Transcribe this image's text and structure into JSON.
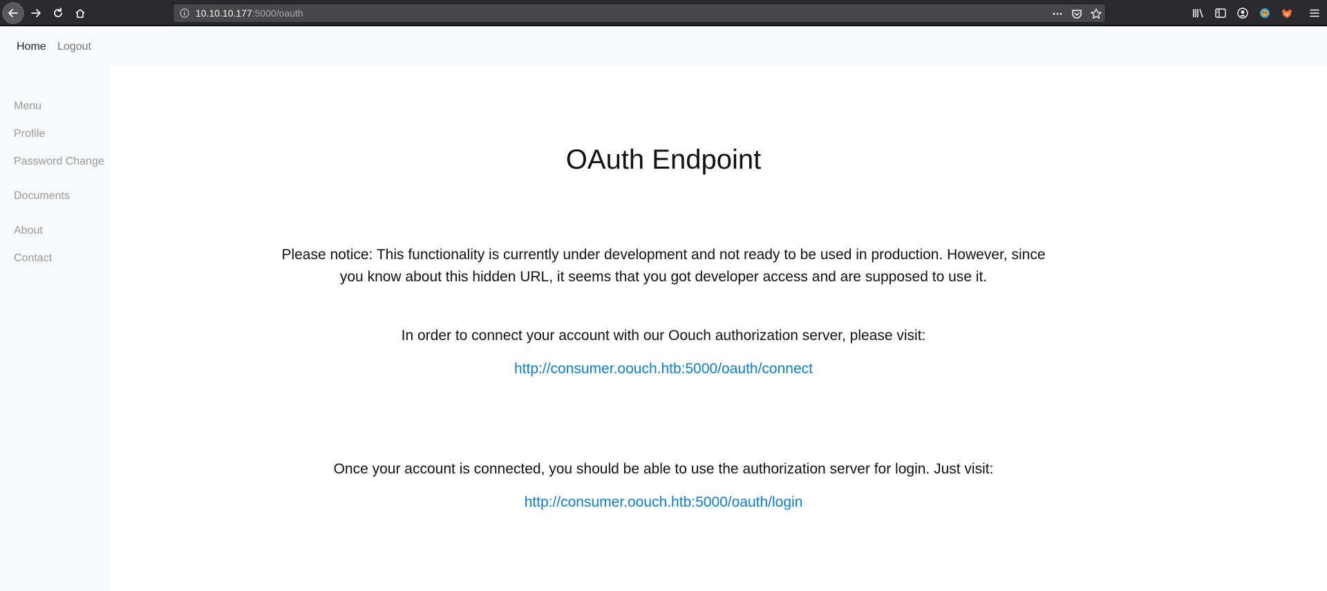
{
  "browser": {
    "url_host": "10.10.10.177",
    "url_path": ":5000/oauth",
    "icons": [
      "back-icon",
      "forward-icon",
      "reload-icon",
      "home-icon",
      "info-icon",
      "more-icon",
      "pocket-icon",
      "bookmark-star-icon",
      "library-icon",
      "sidebar-icon",
      "account-icon",
      "extension-icon",
      "extension-fox-icon",
      "menu-icon"
    ]
  },
  "topnav": {
    "home": "Home",
    "logout": "Logout"
  },
  "sidebar": {
    "items": [
      {
        "label": "Menu"
      },
      {
        "label": "Profile"
      },
      {
        "label": "Password Change"
      },
      {
        "label": "Documents"
      },
      {
        "label": "About"
      },
      {
        "label": "Contact"
      }
    ]
  },
  "main": {
    "title": "OAuth Endpoint",
    "notice_line1": "Please notice: This functionality is currently under development and not ready to be used in production. However, since",
    "notice_line2": "you know about this hidden URL, it seems that you got developer access and are supposed to use it.",
    "connect_text": "In order to connect your account with our Oouch authorization server, please visit:",
    "connect_link": "http://consumer.oouch.htb:5000/oauth/connect",
    "login_text": "Once your account is connected, you should be able to use the authorization server for login. Just visit:",
    "login_link": "http://consumer.oouch.htb:5000/oauth/login"
  },
  "colors": {
    "link": "#0a7fd9",
    "sidebar_text": "#9a9a9a",
    "chrome_bg": "#2a2a2e"
  }
}
